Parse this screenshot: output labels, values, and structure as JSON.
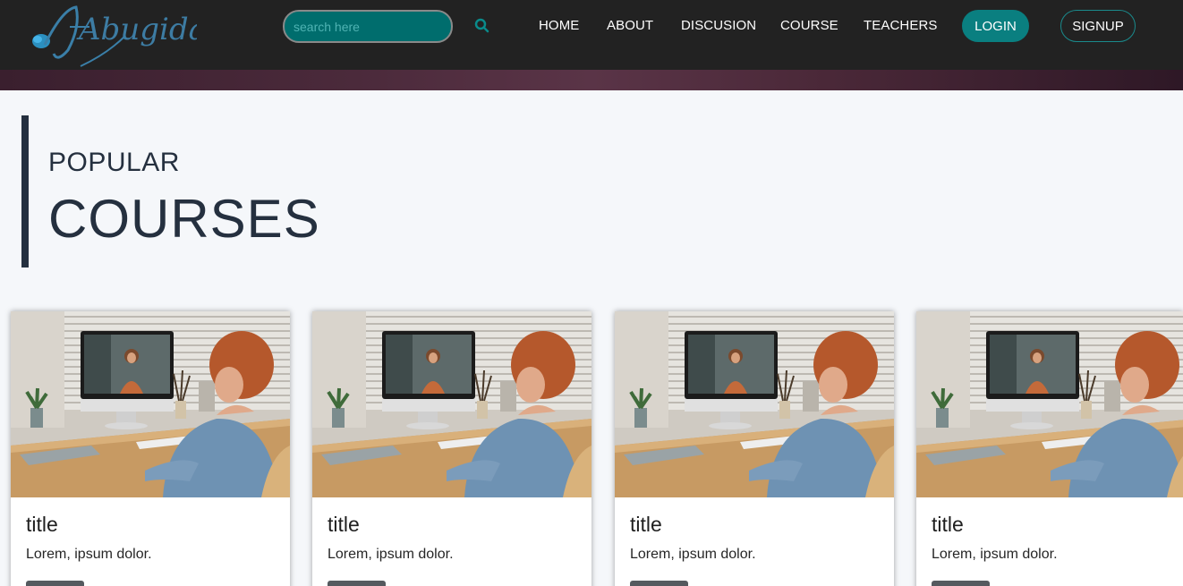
{
  "brand": {
    "logo_text": "Abugida"
  },
  "search": {
    "placeholder": "search here",
    "icon": "search-icon"
  },
  "nav": {
    "links": [
      {
        "label": "HOME"
      },
      {
        "label": "ABOUT"
      },
      {
        "label": "DISCUSION"
      },
      {
        "label": "COURSE"
      },
      {
        "label": "TEACHERS"
      }
    ],
    "login_label": "LOGIN",
    "signup_label": "SIGNUP"
  },
  "section": {
    "subtitle": "POPULAR",
    "title": "COURSES"
  },
  "courses": [
    {
      "title": "title",
      "description": "Lorem, ipsum dolor.",
      "button_label": ""
    },
    {
      "title": "title",
      "description": "Lorem, ipsum dolor.",
      "button_label": ""
    },
    {
      "title": "title",
      "description": "Lorem, ipsum dolor.",
      "button_label": ""
    },
    {
      "title": "title",
      "description": "Lorem, ipsum dolor.",
      "button_label": ""
    }
  ],
  "colors": {
    "navbar_bg": "#222222",
    "accent_teal": "#0a7f80",
    "heading": "#25303f",
    "page_bg": "#f5f7fa"
  }
}
